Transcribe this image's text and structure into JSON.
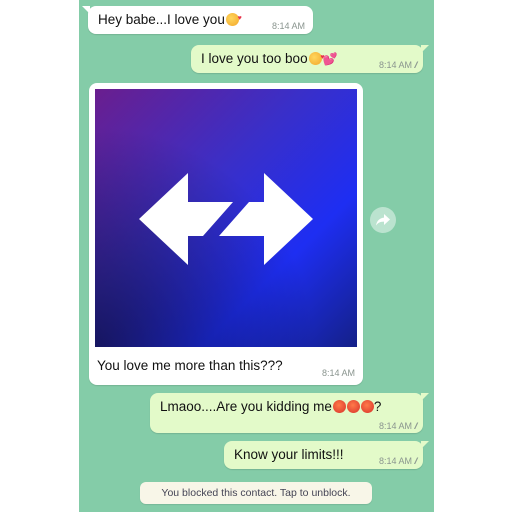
{
  "messages": [
    {
      "direction": "incoming",
      "text": "Hey babe...I love you",
      "emojis": [
        "love-face"
      ],
      "time": "8:14 AM"
    },
    {
      "direction": "outgoing",
      "text": "I love you too boo",
      "emojis": [
        "love-face",
        "sparkling-heart"
      ],
      "time": "8:14 AM",
      "status": "read"
    },
    {
      "direction": "incoming",
      "type": "image",
      "image_description": "Swap arrows logo",
      "caption": "You love me more than this???",
      "time": "8:14 AM"
    },
    {
      "direction": "outgoing",
      "text": "Lmaoo....Are you kidding me",
      "emojis": [
        "angry-face",
        "angry-face",
        "angry-face"
      ],
      "suffix": "?",
      "time": "8:14 AM",
      "status": "read"
    },
    {
      "direction": "outgoing",
      "text": "Know your limits!!!",
      "time": "8:14 AM",
      "status": "read"
    }
  ],
  "system_notice": "You blocked this contact. Tap to unblock.",
  "colors": {
    "chat_background": "#84cca8",
    "incoming_bubble": "#ffffff",
    "outgoing_bubble": "#e3fac9",
    "timestamp": "#8a958f"
  }
}
